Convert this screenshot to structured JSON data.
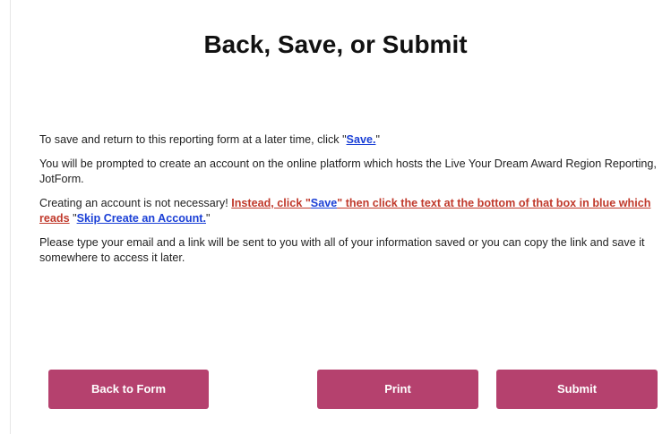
{
  "page": {
    "title": "Back, Save, or Submit"
  },
  "content": {
    "p1_text": "To save and return to this reporting form at a later time, click \"",
    "p1_link": "Save.",
    "p1_end": "\"",
    "p2_text": "You will be prompted to create an account on the online platform which hosts the Live Your Dream Award Region Reporting, JotForm.",
    "p3_start": "Creating an account is not necessary! ",
    "p3_warn_a": "Instead, click \"",
    "p3_save_link": "Save",
    "p3_warn_b": "\" then click the text at the bottom of that box in blue which reads",
    "p3_quote_open": " \"",
    "p3_skip_link": "Skip Create an Account.",
    "p3_quote_close": "\"",
    "p4_text": "Please type your email and a link will be sent to you with all of your information saved or you can copy the link and save it somewhere to access it later."
  },
  "buttons": {
    "back": "Back to Form",
    "print": "Print",
    "submit": "Submit"
  },
  "colors": {
    "button": "#b5416e",
    "link": "#1a3fd6",
    "warning": "#c0392b"
  }
}
